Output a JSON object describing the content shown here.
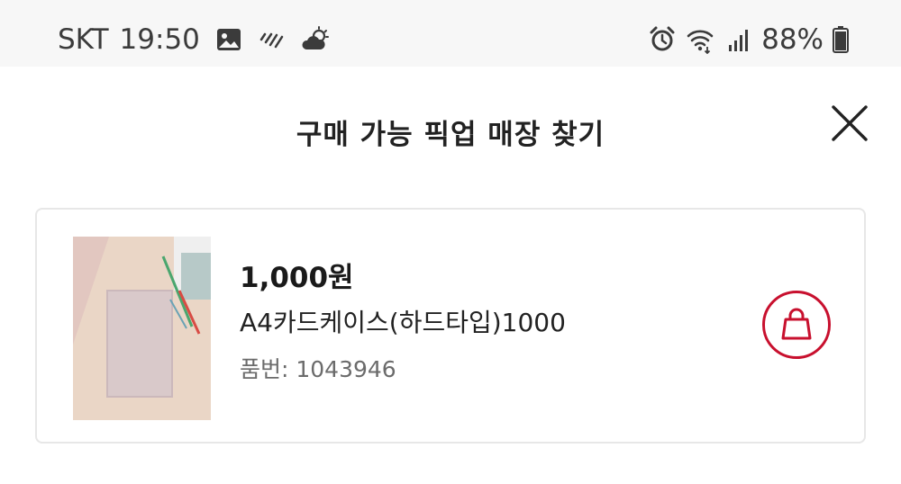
{
  "status_bar": {
    "carrier": "SKT",
    "time": "19:50",
    "battery_percent": "88%",
    "left_icons": [
      "gallery-icon",
      "weather-rain-icon",
      "partly-cloudy-icon"
    ],
    "right_icons": [
      "alarm-icon",
      "wifi-icon",
      "signal-icon",
      "battery-icon"
    ],
    "battery_level": 0.88
  },
  "header": {
    "title": "구매 가능 픽업 매장 찾기",
    "close_icon": "close-icon"
  },
  "product": {
    "price": "1,000원",
    "name": "A4카드케이스(하드타입)1000",
    "code": "품번: 1043946",
    "cart_icon": "shopping-bag-icon"
  },
  "colors": {
    "accent": "#c8102e",
    "status_bar_bg": "#f7f7f7",
    "card_border": "#e7e7e7",
    "muted_text": "#6b6b6b"
  }
}
